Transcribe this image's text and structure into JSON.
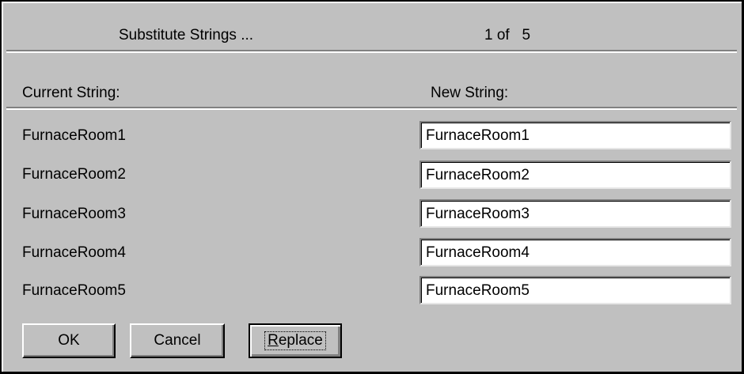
{
  "header": {
    "title": "Substitute Strings ...",
    "page_indicator": "1 of   5"
  },
  "columns": {
    "current": "Current String:",
    "new": "New String:"
  },
  "rows": [
    {
      "current": "FurnaceRoom1",
      "new": "FurnaceRoom1"
    },
    {
      "current": "FurnaceRoom2",
      "new": "FurnaceRoom2"
    },
    {
      "current": "FurnaceRoom3",
      "new": "FurnaceRoom3"
    },
    {
      "current": "FurnaceRoom4",
      "new": "FurnaceRoom4"
    },
    {
      "current": "FurnaceRoom5",
      "new": "FurnaceRoom5"
    }
  ],
  "buttons": {
    "ok": "OK",
    "cancel": "Cancel",
    "replace_mnemonic": "R",
    "replace_rest": "eplace"
  }
}
